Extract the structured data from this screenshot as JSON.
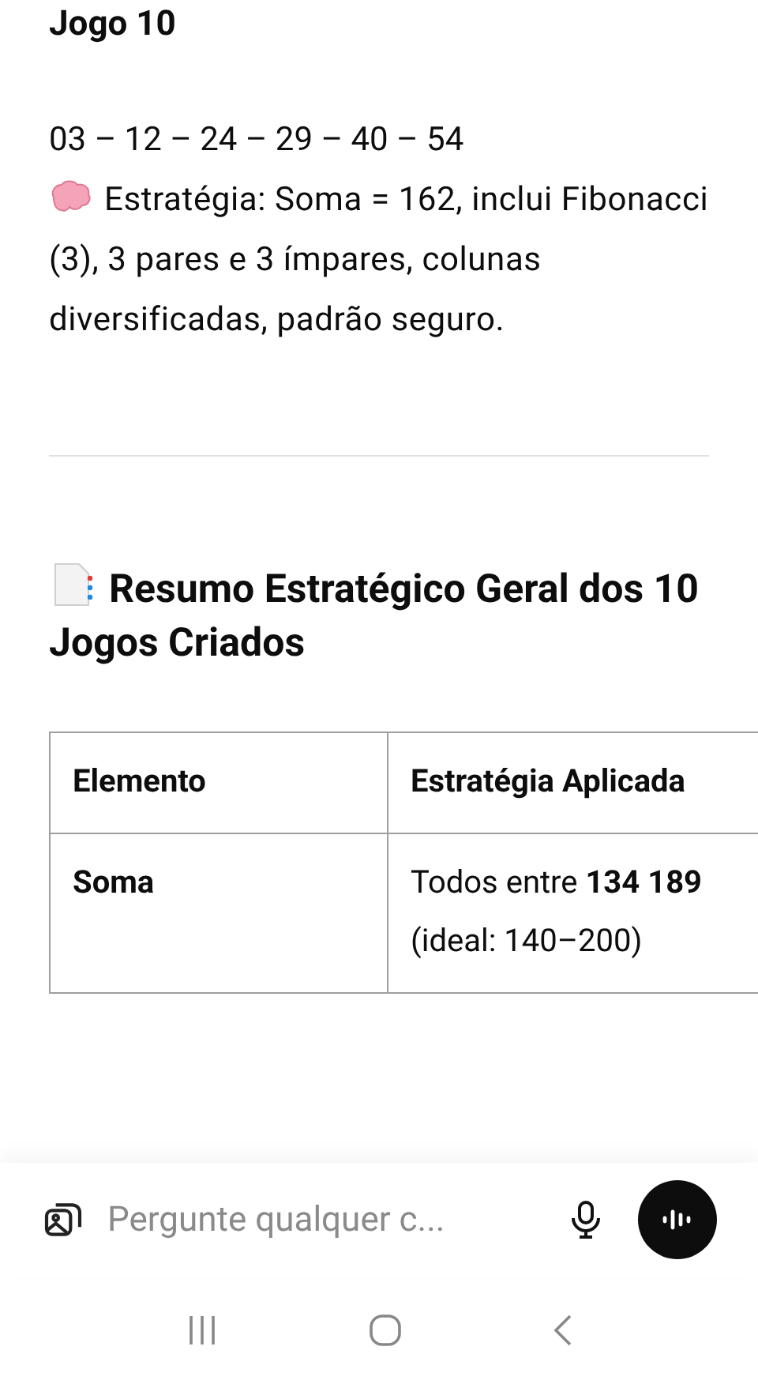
{
  "game": {
    "title": "Jogo 10",
    "numbers": "03 – 12 – 24 – 29 – 40 – 54",
    "strategy": "Estratégia: Soma = 162, inclui Fibonacci (3), 3 pares e 3 ímpares, colunas diversificadas, padrão seguro."
  },
  "summary": {
    "title": "Resumo Estratégico Geral dos 10 Jogos Criados",
    "table": {
      "columns": [
        "Elemento",
        "Estratégia Aplicada"
      ],
      "rows": [
        [
          "Soma",
          "Todos entre **134** **189** (ideal: 140–200)"
        ]
      ]
    }
  },
  "composer": {
    "placeholder": "Pergunte qualquer c..."
  }
}
